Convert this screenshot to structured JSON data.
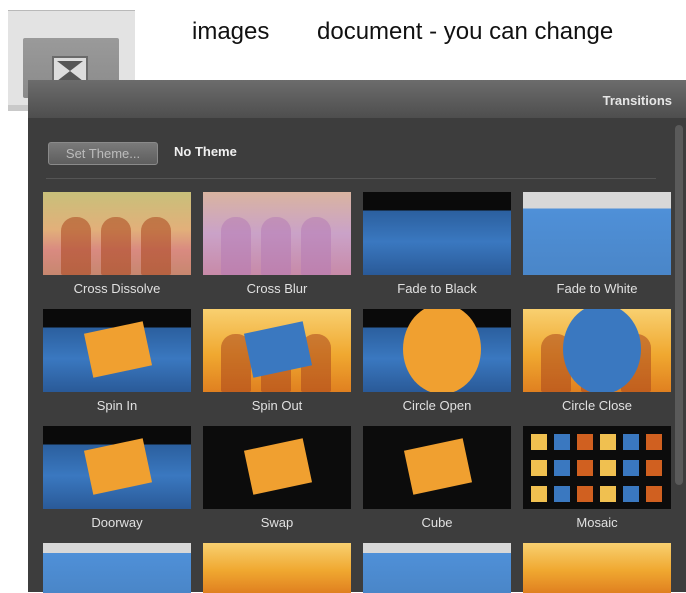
{
  "top_text": {
    "left": "images",
    "right": "document - you can change"
  },
  "toolbar": {
    "icon": "transitions-hourglass-icon"
  },
  "panel": {
    "title": "Transitions",
    "theme_button": "Set Theme...",
    "theme_value": "No Theme"
  },
  "transitions": [
    "Cross Dissolve",
    "Cross Blur",
    "Fade to Black",
    "Fade to White",
    "Spin In",
    "Spin Out",
    "Circle Open",
    "Circle Close",
    "Doorway",
    "Swap",
    "Cube",
    "Mosaic"
  ]
}
